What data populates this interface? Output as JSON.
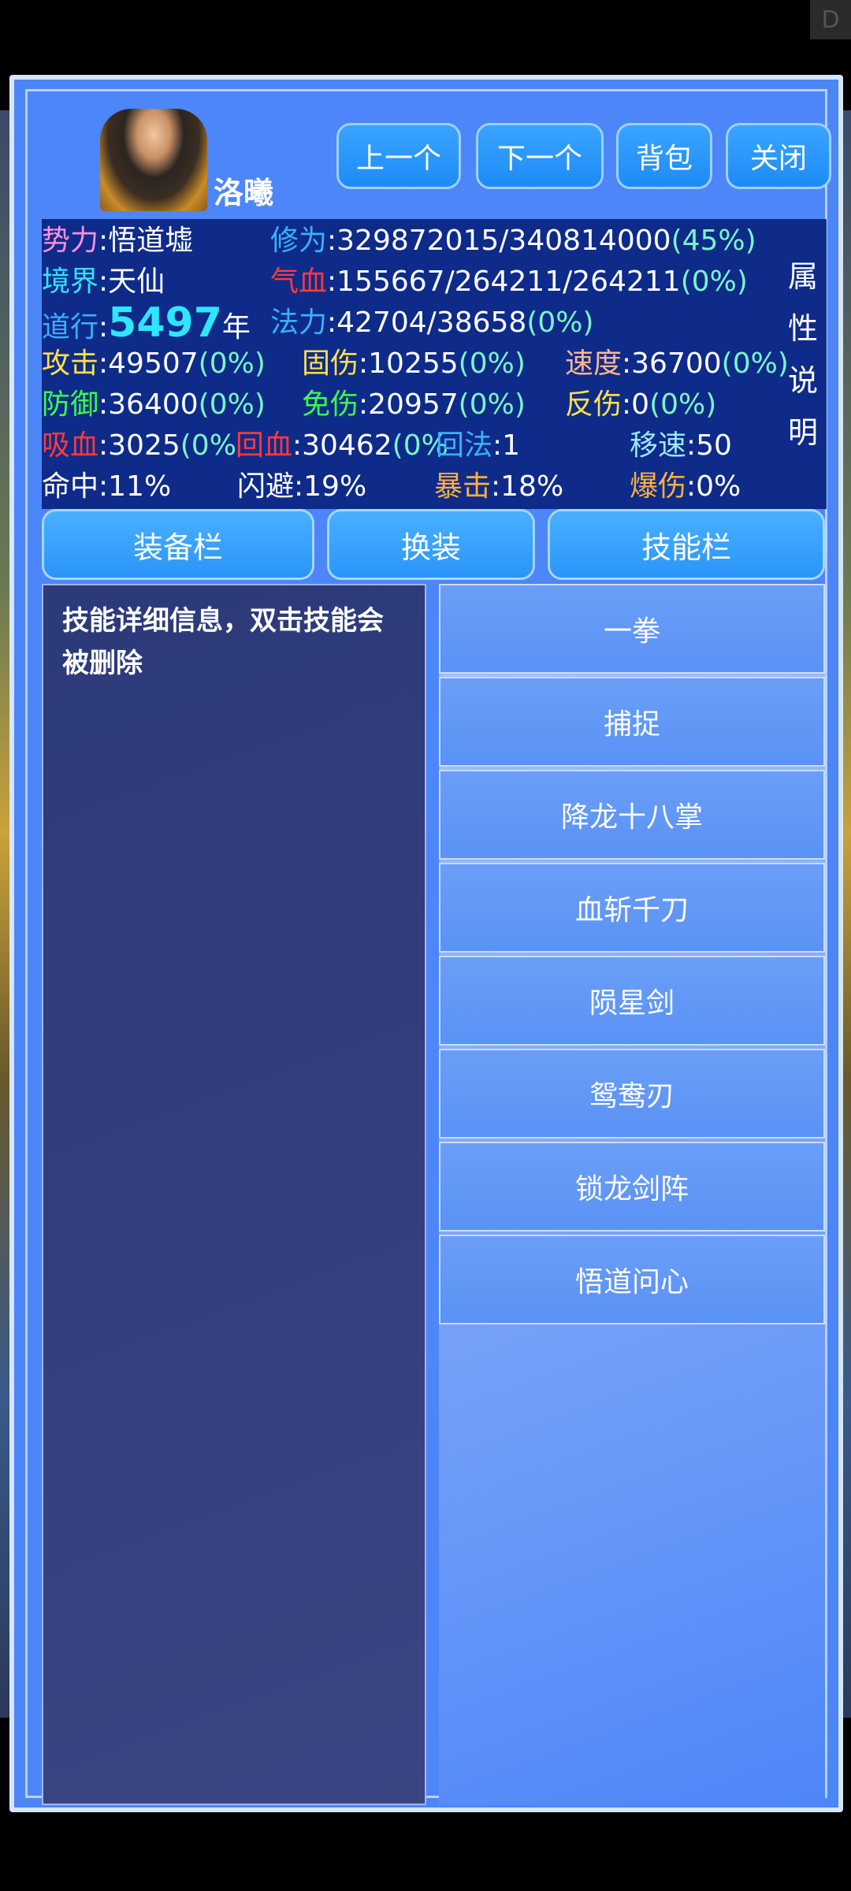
{
  "corner_button": "D",
  "character": {
    "name": "洛曦"
  },
  "top_buttons": {
    "prev": "上一个",
    "next": "下一个",
    "bag": "背包",
    "close": "关闭"
  },
  "stats": {
    "faction_label": "势力",
    "faction_value": ":悟道墟",
    "cultivation_label": "修为",
    "cultivation_value": ":329872015/340814000",
    "cultivation_pct": "(45%)",
    "realm_label": "境界",
    "realm_value": ":天仙",
    "hp_label": "气血",
    "hp_value": ":155667/264211/264211",
    "hp_pct": "(0%)",
    "dao_label": "道行",
    "dao_colon": ":",
    "dao_value": "5497",
    "dao_unit": "年",
    "mana_label": "法力",
    "mana_value": ":42704/38658",
    "mana_pct": "(0%)",
    "attack_label": "攻击",
    "attack_value": ":49507",
    "attack_pct": "(0%)",
    "fixed_dmg_label": "固伤",
    "fixed_dmg_value": ":10255",
    "fixed_dmg_pct": "(0%)",
    "speed_label": "速度",
    "speed_value": ":36700",
    "speed_pct": "(0%)",
    "defense_label": "防御",
    "defense_value": ":36400",
    "defense_pct": "(0%)",
    "dmg_immune_label": "免伤",
    "dmg_immune_value": ":20957",
    "dmg_immune_pct": "(0%)",
    "reflect_label": "反伤",
    "reflect_value": ":0",
    "reflect_pct": "(0%)",
    "lifesteal_label": "吸血",
    "lifesteal_value": ":3025",
    "lifesteal_pct": "(0%",
    "regen_hp_label": "回血",
    "regen_hp_value": ":30462",
    "regen_hp_pct": "(0%",
    "regen_mp_label": "回法",
    "regen_mp_value": ":1",
    "move_speed_label": "移速",
    "move_speed_value": ":50",
    "hit_label": "命中",
    "hit_value": ":11%",
    "dodge_label": "闪避",
    "dodge_value": ":19%",
    "crit_label": "暴击",
    "crit_value": ":18%",
    "crit_dmg_label": "爆伤",
    "crit_dmg_value": ":0%",
    "attr_note": [
      "属",
      "性",
      "说",
      "明"
    ]
  },
  "tabs": {
    "equip": "装备栏",
    "swap": "换装",
    "skill": "技能栏"
  },
  "detail": {
    "text": "技能详细信息，双击技能会被删除"
  },
  "skills": [
    "一拳",
    "捕捉",
    "降龙十八掌",
    "血斩千刀",
    "陨星剑",
    "鸳鸯刃",
    "锁龙剑阵",
    "悟道问心"
  ]
}
